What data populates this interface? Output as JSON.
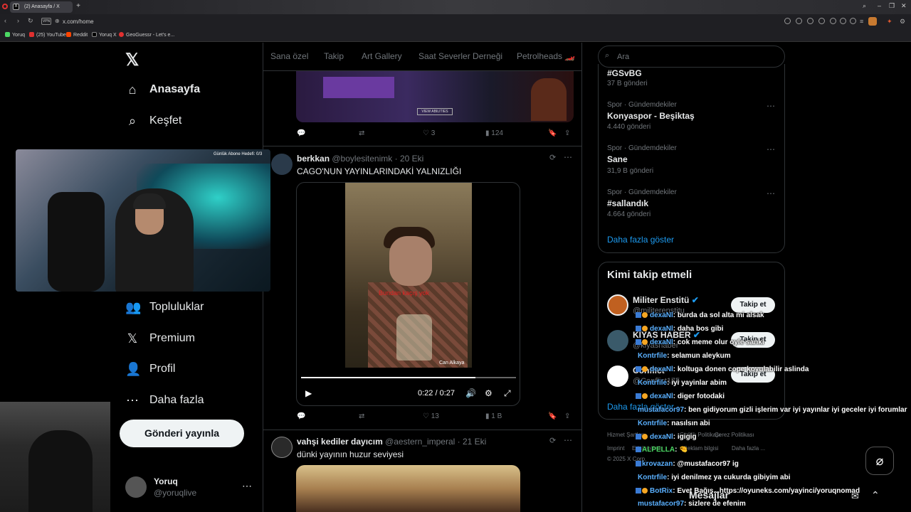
{
  "browser": {
    "tab_title": "(2) Anasayfa / X",
    "url": "x.com/home",
    "vpn_label": "VPN",
    "bookmarks": [
      "Yoruq",
      "(25) YouTube",
      "Reddit",
      "Yoruq X",
      "GeoGuessr - Let's e..."
    ]
  },
  "nav": {
    "items": [
      {
        "label": "Anasayfa",
        "icon": "home-icon",
        "active": true
      },
      {
        "label": "Keşfet",
        "icon": "search-icon"
      },
      {
        "label": "Topluluklar",
        "icon": "communities-icon"
      },
      {
        "label": "Premium",
        "icon": "x-premium-icon"
      },
      {
        "label": "Profil",
        "icon": "profile-icon"
      },
      {
        "label": "Daha fazla",
        "icon": "more-circle-icon"
      }
    ],
    "post_button": "Gönderi yayınla",
    "account": {
      "name": "Yoruq",
      "handle": "@yoruqlive"
    }
  },
  "webcam": {
    "goal_text": "Günlük Abone Hedefi: 0/3"
  },
  "header_tabs": [
    "Sana özel",
    "Takip",
    "Art Gallery",
    "Saat Severler Derneği",
    "Petrolheads 🏎️"
  ],
  "feed": {
    "post1": {
      "media_button": "VIEW ABILITIES",
      "retweets": "",
      "likes": "3",
      "views": "124"
    },
    "post2": {
      "name": "berkkan",
      "handle": "@boylesitenimk",
      "date": "20 Eki",
      "text": "CAGO'NUN YAYINLARINDAKİ YALNIZLIĞI",
      "video_subtitle": "Bundan kaçış yok",
      "video_caption": "Can Alkaya",
      "video_time": "0:22 / 0:27",
      "video_progress": 0.81,
      "likes": "13",
      "views": "1 B"
    },
    "post3": {
      "name": "vahşi kediler dayıcım",
      "handle": "@aestern_imperal",
      "date": "21 Eki",
      "text": "dünki yayının huzur seviyesi"
    }
  },
  "search": {
    "placeholder": "Ara"
  },
  "trends": {
    "items": [
      {
        "meta": "",
        "title": "#GSvBG",
        "count": "37 B gönderi"
      },
      {
        "meta": "Spor · Gündemdekiler",
        "title": "Konyaspor - Beşiktaş",
        "count": "4.440 gönderi"
      },
      {
        "meta": "Spor · Gündemdekiler",
        "title": "Sane",
        "count": "31,9 B gönderi"
      },
      {
        "meta": "Spor · Gündemdekiler",
        "title": "#sallandık",
        "count": "4.664 gönderi"
      }
    ],
    "show_more": "Daha fazla göster"
  },
  "who_to_follow": {
    "title": "Kimi takip etmeli",
    "accounts": [
      {
        "name": "Militer Enstitü",
        "handle": "@militerenstitu",
        "button": "Takip et"
      },
      {
        "name": "KIYAS HABER",
        "handle": "@kiyashaber",
        "button": "Takip et"
      },
      {
        "name": "Conflict",
        "handle": "@Conflict175",
        "button": "Takip et"
      }
    ],
    "show_more": "Daha fazla göster"
  },
  "footer": {
    "links": [
      "Hizmet Şartları",
      "Gizlilik Politikası",
      "Çerez Politikası",
      "Imprint",
      "Erişilebilirlik",
      "Reklam bilgisi",
      "Daha fazla ..."
    ],
    "copyright": "© 2025 X Corp."
  },
  "chat": [
    {
      "user": "dexaNl",
      "msg": ": burda da sol alta mi alsak",
      "badges": 2
    },
    {
      "user": "dexaNl",
      "msg": ": daha bos gibi",
      "badges": 2
    },
    {
      "user": "dexaNl",
      "msg": ": cok meme olur oyle sanki",
      "badges": 2
    },
    {
      "user": "Kontrfile",
      "msg": ": selamun aleykum",
      "badges": 0
    },
    {
      "user": "dexaNl",
      "msg": ": koltuga donen cope koyulabilir aslinda",
      "badges": 2
    },
    {
      "user": "Kontrfile",
      "msg": ": iyi yayinlar abim",
      "badges": 0
    },
    {
      "user": "dexaNl",
      "msg": ": diger fotodaki",
      "badges": 2
    },
    {
      "user": "mustafacor97",
      "msg": ": ben gidiyorum gizli işlerim var iyi yayınlar iyi geceler iyi forumlar",
      "badges": 0
    },
    {
      "user": "Kontrfile",
      "msg": ": nasılsın abi",
      "badges": 0
    },
    {
      "user": "dexaNl",
      "msg": ": igigig",
      "badges": 2
    },
    {
      "user": "ALPELLA",
      "msg": ": 🤏",
      "badges": 1
    },
    {
      "user": "krovazan",
      "msg": ": @mustafacor97 ig",
      "badges": 1
    },
    {
      "user": "Kontrfile",
      "msg": ": iyi denilmez ya cukurda gibiyim abi",
      "badges": 0
    },
    {
      "user": "BotRix",
      "msg": ": Evet Bağış...https://oyuneks.com/yayinci/yoruqnomad",
      "badges": 2
    },
    {
      "user": "mustafacor97",
      "msg": ": sizlere de efenim",
      "badges": 0
    }
  ],
  "messages_label": "Mesajlar"
}
